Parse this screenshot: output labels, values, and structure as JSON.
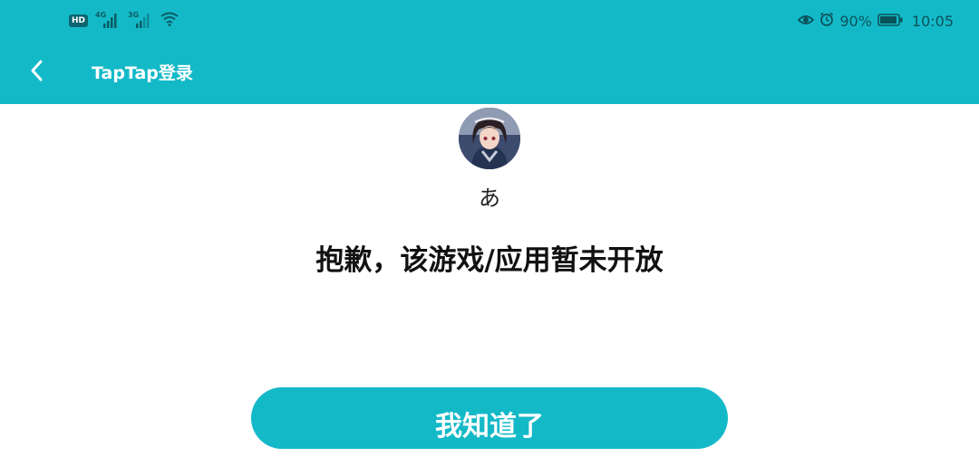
{
  "status_bar": {
    "hd_badge": "HD",
    "network1": "4G",
    "network2": "3G",
    "battery_percent": "90%",
    "time": "10:05",
    "icons": [
      "hd-icon",
      "signal-icon",
      "signal-icon",
      "wifi-icon",
      "eye-icon",
      "alarm-icon",
      "battery-icon"
    ]
  },
  "toolbar": {
    "back_icon": "chevron-left-icon",
    "title": "TapTap登录"
  },
  "profile": {
    "username": "あ"
  },
  "message": "抱歉，该游戏/应用暂未开放",
  "action_button": {
    "label": "我知道了"
  },
  "colors": {
    "accent": "#14b9c8",
    "background": "#ffffff",
    "text": "#111111"
  }
}
